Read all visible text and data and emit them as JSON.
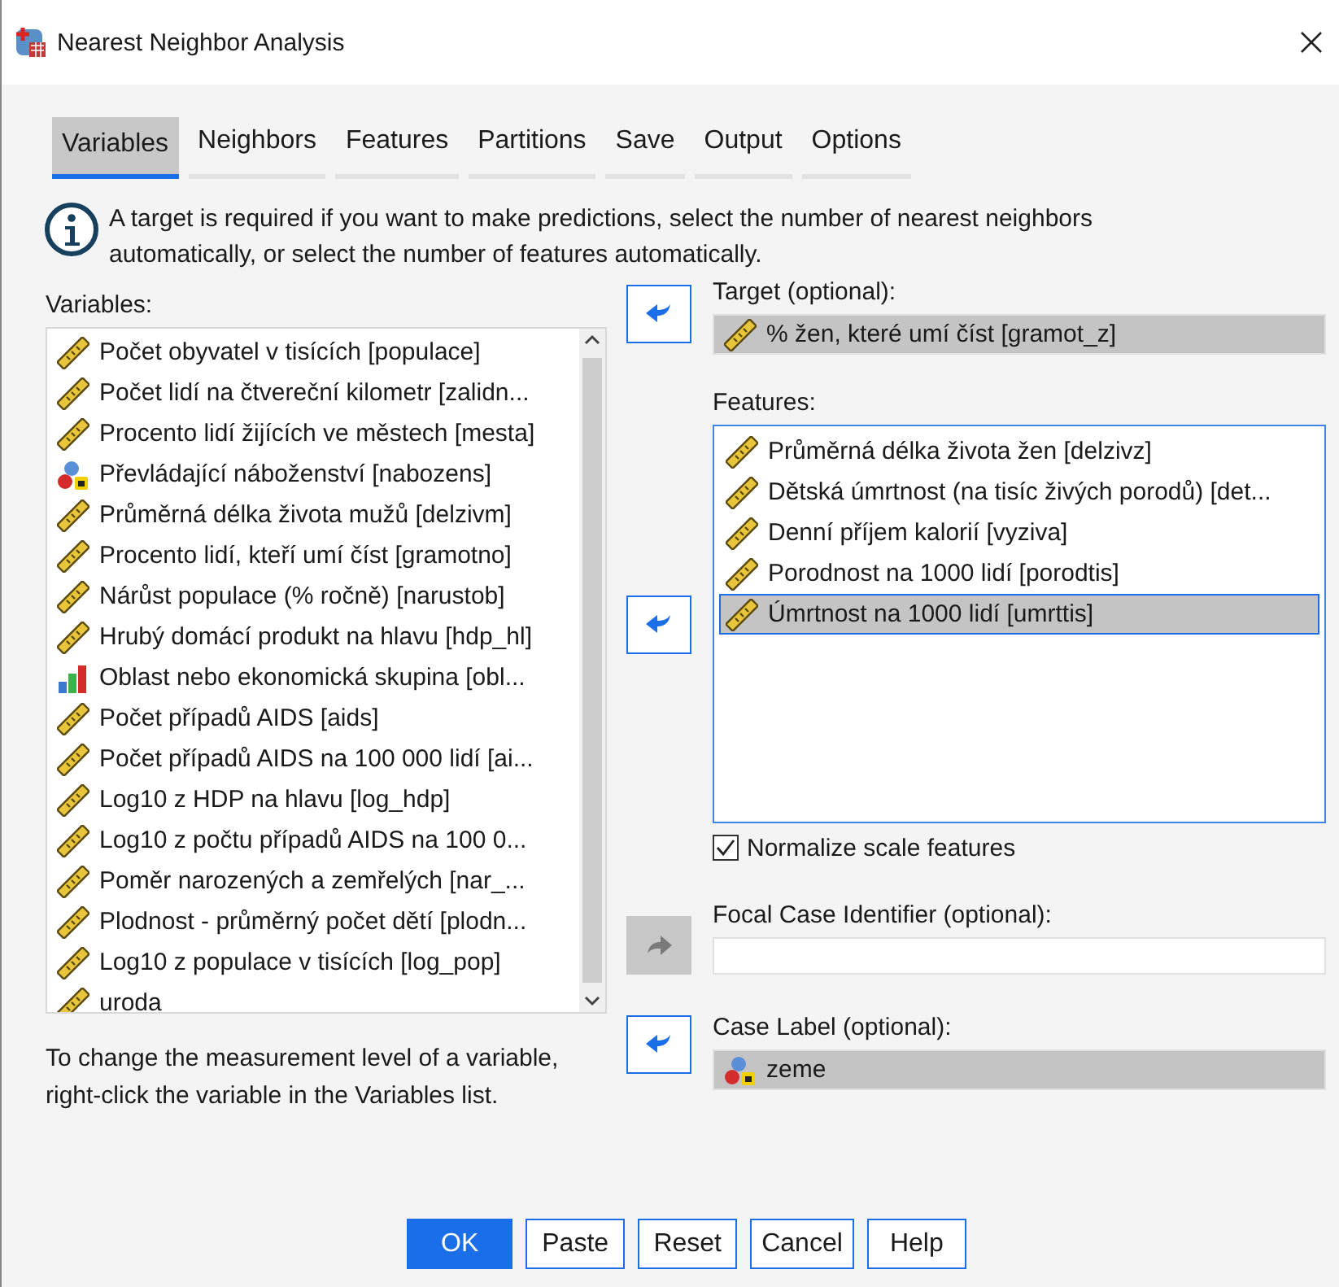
{
  "window": {
    "title": "Nearest Neighbor Analysis"
  },
  "tabs": [
    {
      "label": "Variables",
      "selected": true
    },
    {
      "label": "Neighbors",
      "selected": false
    },
    {
      "label": "Features",
      "selected": false
    },
    {
      "label": "Partitions",
      "selected": false
    },
    {
      "label": "Save",
      "selected": false
    },
    {
      "label": "Output",
      "selected": false
    },
    {
      "label": "Options",
      "selected": false
    }
  ],
  "info": "A target is required if you want to make predictions, select the number of nearest neighbors automatically, or select the number of features automatically.",
  "variables": {
    "label": "Variables:",
    "items": [
      {
        "kind": "scale",
        "text": "Počet obyvatel v tisících [populace]"
      },
      {
        "kind": "scale",
        "text": "Počet lidí na čtvereční kilometr [zalidn..."
      },
      {
        "kind": "scale",
        "text": "Procento lidí žijících ve městech [mesta]"
      },
      {
        "kind": "nominal",
        "text": "Převládající náboženství [nabozens]"
      },
      {
        "kind": "scale",
        "text": "Průměrná délka života mužů [delzivm]"
      },
      {
        "kind": "scale",
        "text": "Procento lidí, kteří umí číst [gramotno]"
      },
      {
        "kind": "scale",
        "text": "Nárůst populace (% ročně) [narustob]"
      },
      {
        "kind": "scale",
        "text": "Hrubý domácí produkt na hlavu [hdp_hl]"
      },
      {
        "kind": "ordinal",
        "text": "Oblast nebo ekonomická skupina [obl..."
      },
      {
        "kind": "scale",
        "text": "Počet případů AIDS [aids]"
      },
      {
        "kind": "scale",
        "text": "Počet případů AIDS na 100 000 lidí [ai..."
      },
      {
        "kind": "scale",
        "text": "Log10 z HDP na hlavu [log_hdp]"
      },
      {
        "kind": "scale",
        "text": "Log10 z počtu případů AIDS na 100 0..."
      },
      {
        "kind": "scale",
        "text": "Poměr narozených a zemřelých [nar_..."
      },
      {
        "kind": "scale",
        "text": "Plodnost - průměrný počet dětí [plodn..."
      },
      {
        "kind": "scale",
        "text": "Log10 z populace v tisících [log_pop]"
      },
      {
        "kind": "scale",
        "text": "uroda"
      }
    ]
  },
  "hint": "To change the measurement level of a variable, right-click the variable in the Variables list.",
  "target": {
    "label": "Target (optional):",
    "move_disabled": false,
    "value": {
      "kind": "scale",
      "text": "% žen, které umí číst [gramot_z]"
    }
  },
  "features": {
    "label": "Features:",
    "move_disabled": false,
    "items": [
      {
        "kind": "scale",
        "text": "Průměrná délka života žen [delzivz]",
        "selected": false
      },
      {
        "kind": "scale",
        "text": "Dětská úmrtnost (na tisíc živých porodů) [det...",
        "selected": false
      },
      {
        "kind": "scale",
        "text": "Denní příjem kalorií [vyziva]",
        "selected": false
      },
      {
        "kind": "scale",
        "text": "Porodnost na 1000 lidí [porodtis]",
        "selected": false
      },
      {
        "kind": "scale",
        "text": "Úmrtnost na 1000 lidí [umrttis]",
        "selected": true
      }
    ]
  },
  "normalize": {
    "label": "Normalize scale features",
    "checked": true
  },
  "focal": {
    "label": "Focal Case Identifier (optional):",
    "move_disabled": true
  },
  "case_label": {
    "label": "Case Label (optional):",
    "move_disabled": false,
    "value": {
      "kind": "nominal",
      "text": "zeme"
    }
  },
  "buttons": [
    {
      "label": "OK",
      "default": true
    },
    {
      "label": "Paste",
      "default": false
    },
    {
      "label": "Reset",
      "default": false
    },
    {
      "label": "Cancel",
      "default": false
    },
    {
      "label": "Help",
      "default": false
    }
  ]
}
